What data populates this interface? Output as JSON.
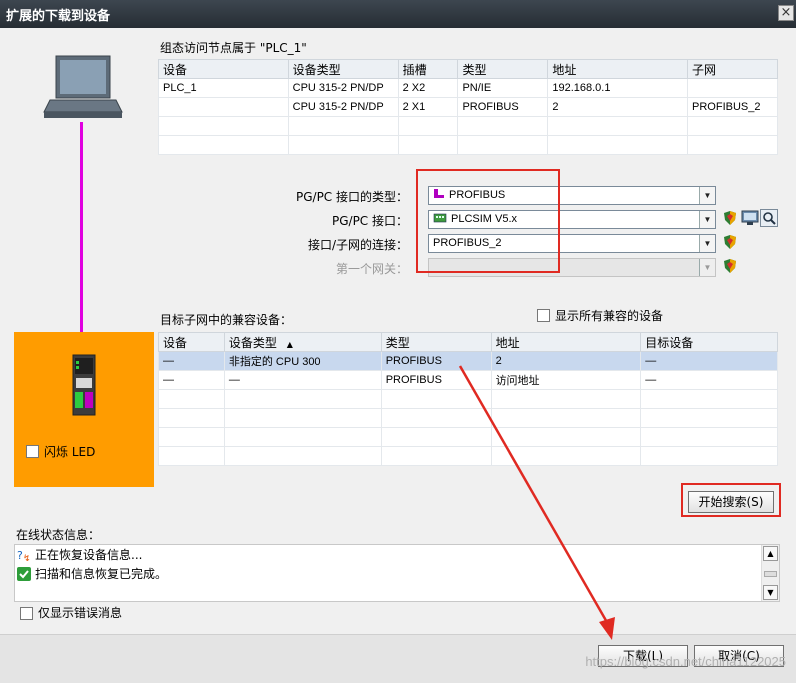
{
  "title": "扩展的下载到设备",
  "close_glyph": "×",
  "node_section": {
    "label": "组态访问节点属于 \"PLC_1\"",
    "columns": [
      "设备",
      "设备类型",
      "插槽",
      "类型",
      "地址",
      "子网"
    ],
    "rows": [
      [
        "PLC_1",
        "CPU 315-2 PN/DP",
        "2 X2",
        "PN/IE",
        "192.168.0.1",
        ""
      ],
      [
        "",
        "CPU 315-2 PN/DP",
        "2 X1",
        "PROFIBUS",
        "2",
        "PROFIBUS_2"
      ],
      [
        "",
        "",
        "",
        "",
        "",
        ""
      ],
      [
        "",
        "",
        "",
        "",
        "",
        ""
      ]
    ]
  },
  "interface": {
    "type_label": "PG/PC 接口的类型：",
    "type_value": "PROFIBUS",
    "iface_label": "PG/PC 接口：",
    "iface_value": "PLCSIM V5.x",
    "conn_label": "接口/子网的连接：",
    "conn_value": "PROFIBUS_2",
    "gateway_label": "第一个网关：",
    "gateway_value": ""
  },
  "compatible": {
    "label": "目标子网中的兼容设备：",
    "show_all_label": "显示所有兼容的设备",
    "sort_glyph": "▲",
    "columns": [
      "设备",
      "设备类型",
      "类型",
      "地址",
      "目标设备"
    ],
    "rows": [
      [
        "—",
        "非指定的 CPU 300",
        "PROFIBUS",
        "2",
        "—"
      ],
      [
        "—",
        "—",
        "PROFIBUS",
        "访问地址",
        "—"
      ],
      [
        "",
        "",
        "",
        "",
        ""
      ],
      [
        "",
        "",
        "",
        "",
        ""
      ],
      [
        "",
        "",
        "",
        "",
        ""
      ],
      [
        "",
        "",
        "",
        "",
        ""
      ]
    ]
  },
  "flash_led_label": "闪烁 LED",
  "start_search_label": "开始搜索(S)",
  "status": {
    "label": "在线状态信息：",
    "messages": [
      {
        "icon": "searching-icon",
        "text": "正在恢复设备信息..."
      },
      {
        "icon": "success-check-icon",
        "text": "扫描和信息恢复已完成。"
      }
    ]
  },
  "only_errors_label": "仅显示错误消息",
  "download_label": "下载(L)",
  "cancel_label": "取消(C)",
  "watermark": "https://blog.csdn.net/china1122025",
  "colors": {
    "accent_red": "#e02a22",
    "profibus_purple": "#e000e0",
    "panel_orange": "#ff9c00",
    "selected_row": "#c8d8ee"
  }
}
